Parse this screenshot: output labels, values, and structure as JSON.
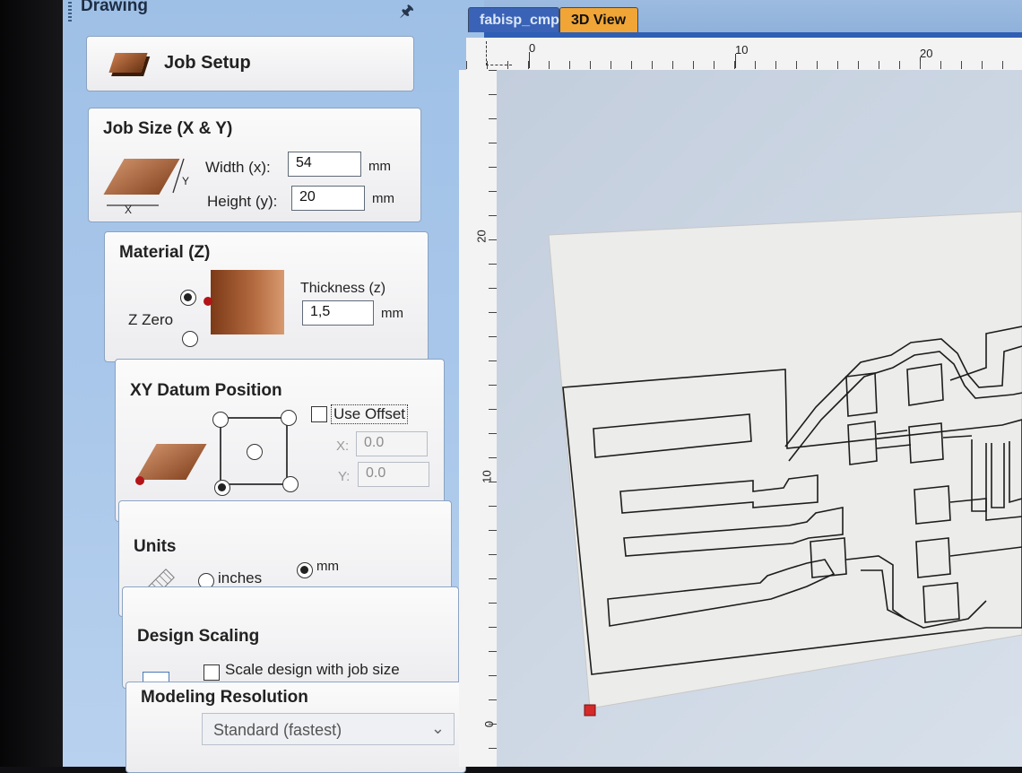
{
  "panel": {
    "title": "Drawing",
    "pin_icon": "pin-icon"
  },
  "job_setup": {
    "label": "Job Setup"
  },
  "job_size": {
    "title": "Job Size (X & Y)",
    "width_label": "Width (x):",
    "width_value": "54",
    "height_label": "Height (y):",
    "height_value": "20",
    "unit": "mm",
    "axis_x": "X",
    "axis_y": "Y"
  },
  "material": {
    "title": "Material (Z)",
    "zzero_label": "Z Zero",
    "thickness_label": "Thickness (z)",
    "thickness_value": "1,5",
    "unit": "mm"
  },
  "datum": {
    "title": "XY Datum Position",
    "use_offset_label": "Use Offset",
    "x_label": "X:",
    "x_value": "0.0",
    "y_label": "Y:",
    "y_value": "0.0"
  },
  "units": {
    "title": "Units",
    "inches_label": "inches",
    "mm_label": "mm",
    "selected": "mm"
  },
  "scaling": {
    "title": "Design Scaling",
    "checkbox_label": "Scale design with job size"
  },
  "modeling": {
    "title": "Modeling Resolution",
    "selected_value": "Standard (fastest)"
  },
  "document": {
    "tabs": [
      {
        "label": "fabisp_cmp",
        "active": true
      },
      {
        "label": "3D View",
        "active": false
      }
    ],
    "hruler_labels": [
      "0",
      "10",
      "20"
    ],
    "vruler_labels": [
      "20",
      "10",
      "0"
    ]
  },
  "colors": {
    "panel_bg": "#a9c7ea",
    "tab_active": "#3a63b7",
    "tab_3d": "#f0a536",
    "material": "#a15a31",
    "origin_marker": "#d42a2a"
  }
}
